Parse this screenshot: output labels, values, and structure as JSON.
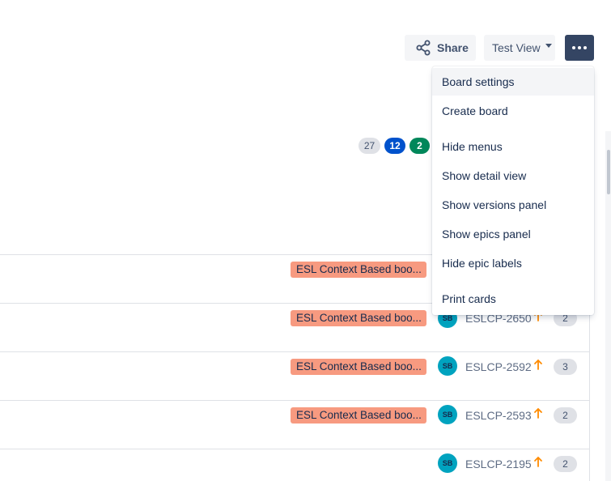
{
  "toolbar": {
    "share_label": "Share",
    "view_label": "Test View",
    "more_icon": "more-icon",
    "share_icon": "share-icon"
  },
  "counters": {
    "total": "27",
    "in_progress": "12",
    "done": "2"
  },
  "menu": {
    "items": [
      {
        "label": "Board settings"
      },
      {
        "label": "Create board"
      },
      {
        "label": "Hide menus"
      },
      {
        "label": "Show detail view"
      },
      {
        "label": "Show versions panel"
      },
      {
        "label": "Show epics panel"
      },
      {
        "label": "Hide epic labels"
      },
      {
        "label": "Print cards"
      }
    ]
  },
  "issues": [
    {
      "epic": "ESL Context Based boo...",
      "avatar": "",
      "key": "",
      "points": ""
    },
    {
      "epic": "ESL Context Based boo...",
      "avatar": "SB",
      "key": "ESLCP-2650",
      "points": "2"
    },
    {
      "epic": "ESL Context Based boo...",
      "avatar": "SB",
      "key": "ESLCP-2592",
      "points": "3"
    },
    {
      "epic": "ESL Context Based boo...",
      "avatar": "SB",
      "key": "ESLCP-2593",
      "points": "2"
    },
    {
      "epic": "",
      "avatar": "SB",
      "key": "ESLCP-2195",
      "points": "2"
    }
  ],
  "colors": {
    "epic": "#f79a80",
    "avatar": "#00a3bf",
    "priority_high": "#ff8b00",
    "counter_blue": "#0052cc",
    "counter_green": "#00875a",
    "more_button": "#344563"
  }
}
